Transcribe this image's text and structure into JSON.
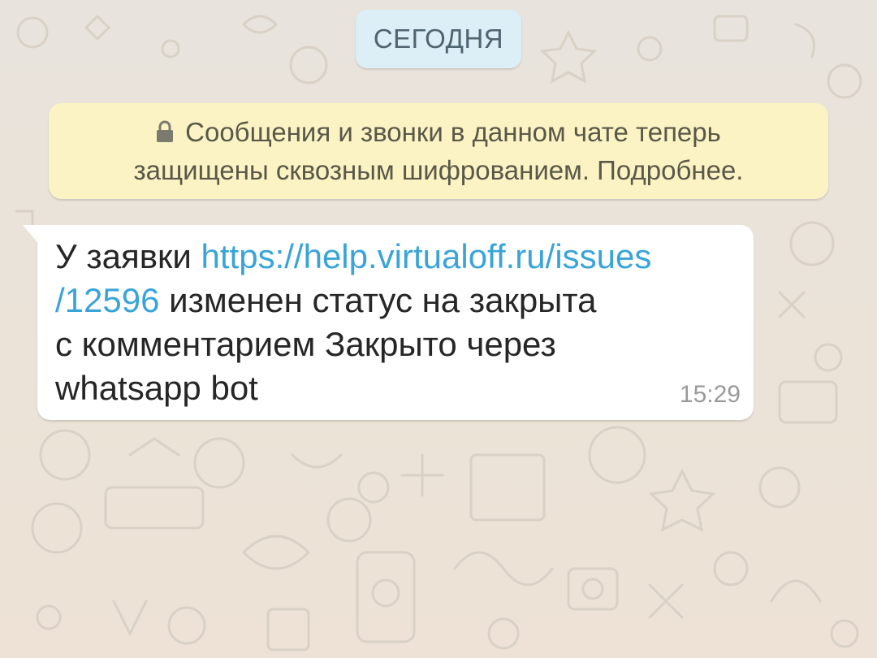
{
  "chat": {
    "date_chip": "СЕГОДНЯ",
    "encryption_notice": {
      "icon": "lock-icon",
      "line1": "Сообщения и звонки в данном чате теперь",
      "line2": "защищены сквозным шифрованием. Подробнее."
    },
    "message": {
      "text_before_link": "У заявки ",
      "link_part1": "https://help.virtualoff.ru/issues",
      "link_part2": "/12596",
      "text_after_link": " изменен статус на закрыта",
      "line3": "с комментарием Закрыто через",
      "line4": "whatsapp bot",
      "time": "15:29"
    }
  },
  "colors": {
    "wallpaper": "#e9e2d8",
    "date_chip_bg": "#dceef6",
    "notice_bg": "#fbf3c3",
    "bubble_bg": "#ffffff",
    "link": "#3aa4d8"
  }
}
